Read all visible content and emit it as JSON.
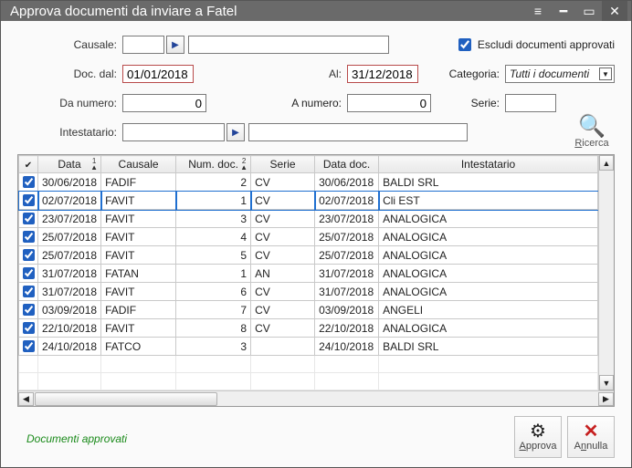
{
  "window": {
    "title": "Approva documenti da inviare a Fatel"
  },
  "labels": {
    "causale": "Causale:",
    "docdal": "Doc. dal:",
    "al": "Al:",
    "danumero": "Da numero:",
    "anumero": "A numero:",
    "intestatario": "Intestatario:",
    "escludi": "Escludi documenti approvati",
    "categoria": "Categoria:",
    "serie": "Serie:",
    "ricerca": "Ricerca",
    "legend": "Documenti approvati",
    "approva": "Approva",
    "annulla": "Annulla"
  },
  "filters": {
    "causale_code": "",
    "causale_desc": "",
    "doc_dal": "01/01/2018",
    "doc_al": "31/12/2018",
    "da_numero": "0",
    "a_numero": "0",
    "intest_code": "",
    "intest_desc": "",
    "escludi_approvati": true,
    "categoria": "Tutti i documenti",
    "serie": ""
  },
  "columns": {
    "data": "Data",
    "causale": "Causale",
    "numdoc": "Num. doc.",
    "serie": "Serie",
    "datadoc": "Data doc.",
    "intest": "Intestatario"
  },
  "rows": [
    {
      "chk": true,
      "data": "30/06/2018",
      "causale": "FADIF",
      "num": "2",
      "serie": "CV",
      "datadoc": "30/06/2018",
      "intest": "BALDI SRL",
      "sel": false
    },
    {
      "chk": true,
      "data": "02/07/2018",
      "causale": "FAVIT",
      "num": "1",
      "serie": "CV",
      "datadoc": "02/07/2018",
      "intest": "Cli EST",
      "sel": true
    },
    {
      "chk": true,
      "data": "23/07/2018",
      "causale": "FAVIT",
      "num": "3",
      "serie": "CV",
      "datadoc": "23/07/2018",
      "intest": "ANALOGICA",
      "sel": false
    },
    {
      "chk": true,
      "data": "25/07/2018",
      "causale": "FAVIT",
      "num": "4",
      "serie": "CV",
      "datadoc": "25/07/2018",
      "intest": "ANALOGICA",
      "sel": false
    },
    {
      "chk": true,
      "data": "25/07/2018",
      "causale": "FAVIT",
      "num": "5",
      "serie": "CV",
      "datadoc": "25/07/2018",
      "intest": "ANALOGICA",
      "sel": false
    },
    {
      "chk": true,
      "data": "31/07/2018",
      "causale": "FATAN",
      "num": "1",
      "serie": "AN",
      "datadoc": "31/07/2018",
      "intest": "ANALOGICA",
      "sel": false
    },
    {
      "chk": true,
      "data": "31/07/2018",
      "causale": "FAVIT",
      "num": "6",
      "serie": "CV",
      "datadoc": "31/07/2018",
      "intest": "ANALOGICA",
      "sel": false
    },
    {
      "chk": true,
      "data": "03/09/2018",
      "causale": "FADIF",
      "num": "7",
      "serie": "CV",
      "datadoc": "03/09/2018",
      "intest": "ANGELI",
      "sel": false
    },
    {
      "chk": true,
      "data": "22/10/2018",
      "causale": "FAVIT",
      "num": "8",
      "serie": "CV",
      "datadoc": "22/10/2018",
      "intest": "ANALOGICA",
      "sel": false
    },
    {
      "chk": true,
      "data": "24/10/2018",
      "causale": "FATCO",
      "num": "3",
      "serie": "",
      "datadoc": "24/10/2018",
      "intest": "BALDI SRL",
      "sel": false
    }
  ]
}
